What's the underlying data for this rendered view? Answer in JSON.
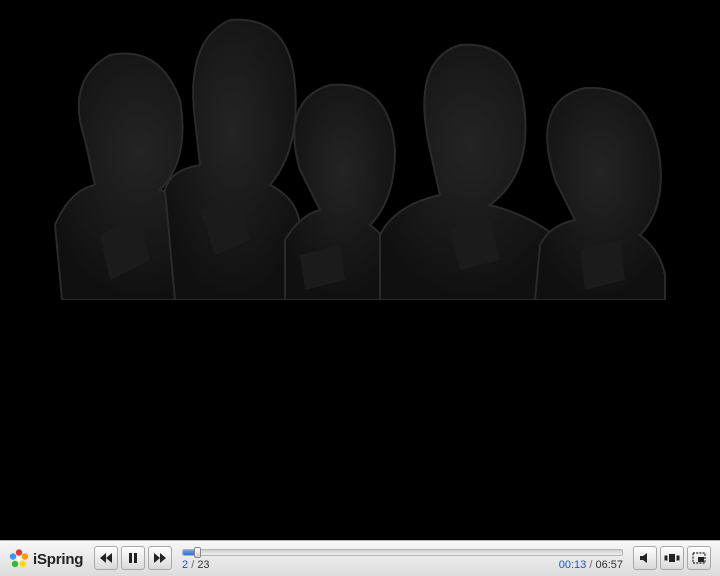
{
  "brand": {
    "logo_text": "iSpring"
  },
  "slide": {
    "current": "2",
    "separator": "/",
    "total": "23"
  },
  "time": {
    "elapsed": "00:13",
    "separator": "/",
    "duration": "06:57"
  },
  "progress": {
    "fraction": 0.031
  },
  "icons": {
    "logo": "ispring-flower-icon",
    "prev": "rewind-icon",
    "pause": "pause-icon",
    "next": "fast-forward-icon",
    "volume": "speaker-icon",
    "layout": "slide-layout-icon",
    "fullscreen": "fullscreen-icon"
  },
  "colors": {
    "accent": "#2f6fd6",
    "bar": "#e6e6e6",
    "stage": "#000000"
  }
}
